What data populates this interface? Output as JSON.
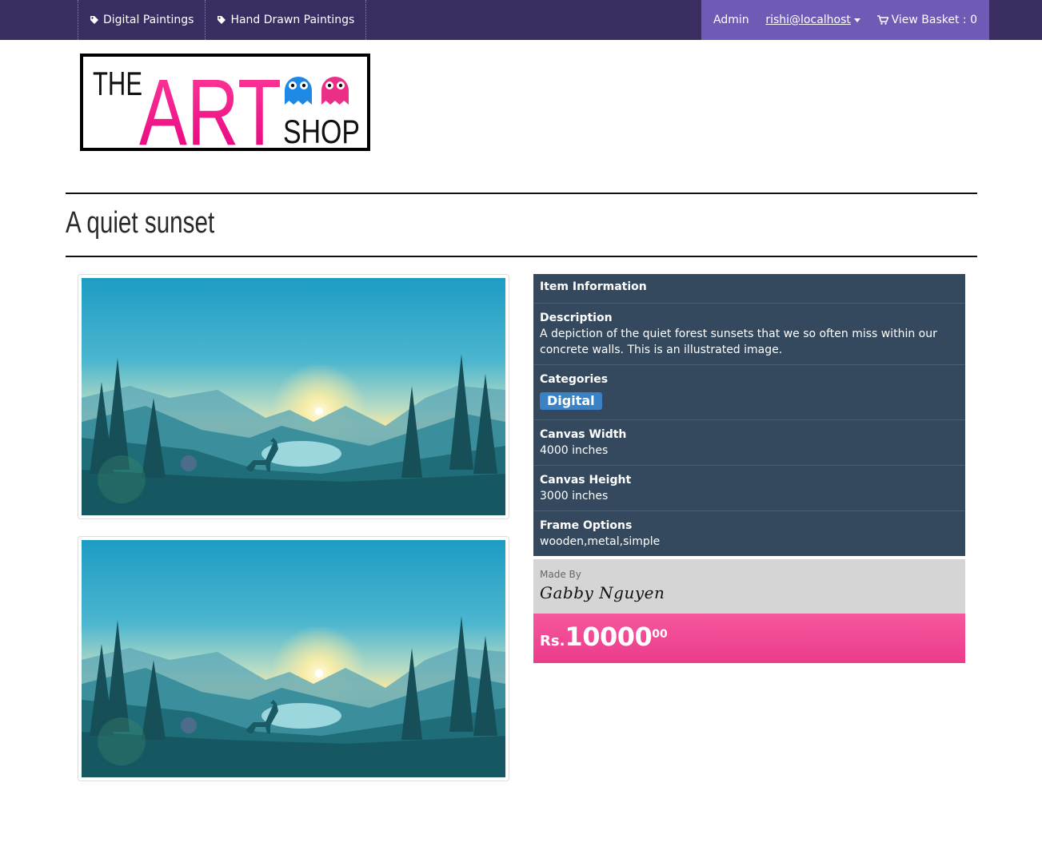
{
  "nav": {
    "left": [
      {
        "label": "Digital Paintings"
      },
      {
        "label": "Hand Drawn Paintings"
      }
    ],
    "admin": "Admin",
    "user": "rishi@localhost",
    "basket": "View Basket : 0"
  },
  "logo": {
    "the": "THE",
    "art": "ART",
    "shop": "SHOP"
  },
  "product": {
    "title": "A quiet sunset",
    "info_header": "Item Information",
    "description_label": "Description",
    "description": "A depiction of the quiet forest sunsets that we so often miss within our concrete walls. This is an illustrated image.",
    "categories_label": "Categories",
    "category": "Digital",
    "width_label": "Canvas Width",
    "width": "4000 inches",
    "height_label": "Canvas Height",
    "height": "3000 inches",
    "frame_label": "Frame Options",
    "frame": "wooden,metal,simple",
    "made_by_label": "Made By",
    "artist": "Gabby Nguyen",
    "currency": "Rs.",
    "price": "10000",
    "price_cents": "00"
  },
  "colors": {
    "navbar": "#392d62",
    "nav_right": "#6f5ab5",
    "panel": "#34495e",
    "price": "#ec3b8c",
    "badge": "#3a82c4"
  }
}
